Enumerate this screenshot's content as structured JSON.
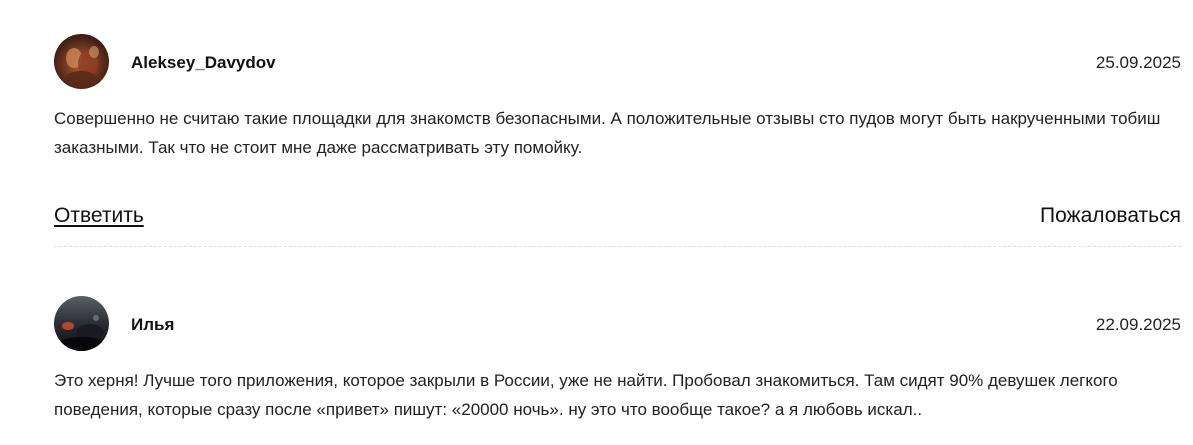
{
  "comments": [
    {
      "author": "Aleksey_Davydov",
      "date": "25.09.2025",
      "text": "Совершенно не считаю такие площадки для знакомств безопасными. А положительные отзывы сто пудов могут быть накрученными тобиш заказными. Так что не стоит мне даже рассматривать эту помойку.",
      "reply_label": "Ответить",
      "report_label": "Пожаловаться"
    },
    {
      "author": "Илья",
      "date": "22.09.2025",
      "text": "Это херня! Лучше того приложения, которое закрыли в России, уже не найти. Пробовал знакомиться. Там сидят 90% девушек легкого поведения, которые сразу после «привет» пишут: «20000 ночь». ну это что вообще такое? а я любовь искал.."
    }
  ],
  "colors": {
    "text": "#222222",
    "divider": "#dcdcdc",
    "background": "#ffffff"
  }
}
